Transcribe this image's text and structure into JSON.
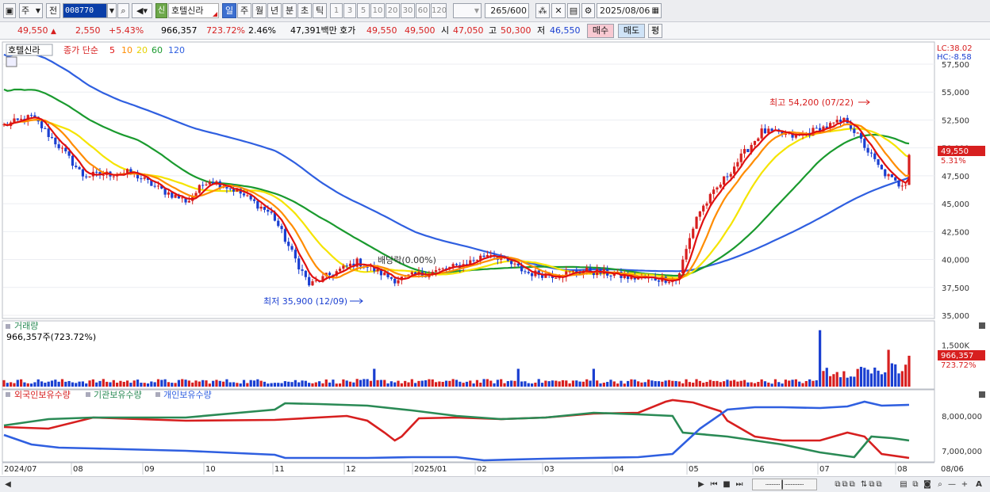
{
  "toolbar": {
    "market_type": "주",
    "prev_label": "전",
    "stock_code": "008770",
    "stock_name": "호텔신라",
    "credit_badge": "신",
    "periods": [
      "일",
      "주",
      "월",
      "년",
      "분",
      "초",
      "틱"
    ],
    "active_period": "일",
    "minute_intervals": [
      "1",
      "3",
      "5",
      "10",
      "20",
      "30",
      "60",
      "120"
    ],
    "bar_count": "265",
    "bar_total": "/600",
    "date": "2025/08/06"
  },
  "quote": {
    "price": "49,550",
    "change": "2,550",
    "change_pct": "+5.43%",
    "volume": "966,357",
    "volume_ratio": "723.72%",
    "turnover": "2.46%",
    "trade_value": "47,391백만",
    "ask_label": "호가",
    "ask": "49,550",
    "bid": "49,500",
    "open_label": "시",
    "open": "47,050",
    "high_label": "고",
    "high": "50,300",
    "low_label": "저",
    "low": "46,550",
    "buy_label": "매수",
    "sell_label": "매도",
    "eval_label": "평"
  },
  "price_panel": {
    "stock_name": "호텔신라",
    "ma_label": "종가 단순",
    "ma_periods": [
      "5",
      "10",
      "20",
      "60",
      "120"
    ],
    "lc": "LC:38.02",
    "hc": "HC:-8.58",
    "y_labels": [
      "57,500",
      "55,000",
      "52,500",
      "50,000",
      "47,500",
      "45,000",
      "42,500",
      "40,000",
      "37,500",
      "35,000"
    ],
    "current_price": "49,550",
    "current_pct": "5.31%",
    "high_annotation": "최고 54,200 (07/22)",
    "low_annotation": "최저 35,900 (12/09)",
    "dividend_annotation": "배당락(0.00%)"
  },
  "volume_panel": {
    "title": "거래량",
    "detail": "966,357주(723.72%)",
    "y_label": "1,500K",
    "current": "966,357",
    "current_pct": "723.72%"
  },
  "holding_panel": {
    "series": [
      "외국인보유수량",
      "기관보유수량",
      "개인보유수량"
    ],
    "y_labels": [
      "8,000,000",
      "7,000,000"
    ]
  },
  "x_axis": [
    "2024/07",
    "08",
    "09",
    "10",
    "11",
    "12",
    "2025/01",
    "02",
    "03",
    "04",
    "05",
    "06",
    "07",
    "08",
    "08/06"
  ],
  "colors": {
    "up": "#d71f1f",
    "down": "#1a3fd1",
    "ma5": "#e01010",
    "ma10": "#ff8c00",
    "ma20": "#f5e400",
    "ma60": "#1a9a2e",
    "ma120": "#2f5fe0",
    "foreign": "#d71f1f",
    "institution": "#2a8a55",
    "retail": "#2f5fe0"
  }
}
